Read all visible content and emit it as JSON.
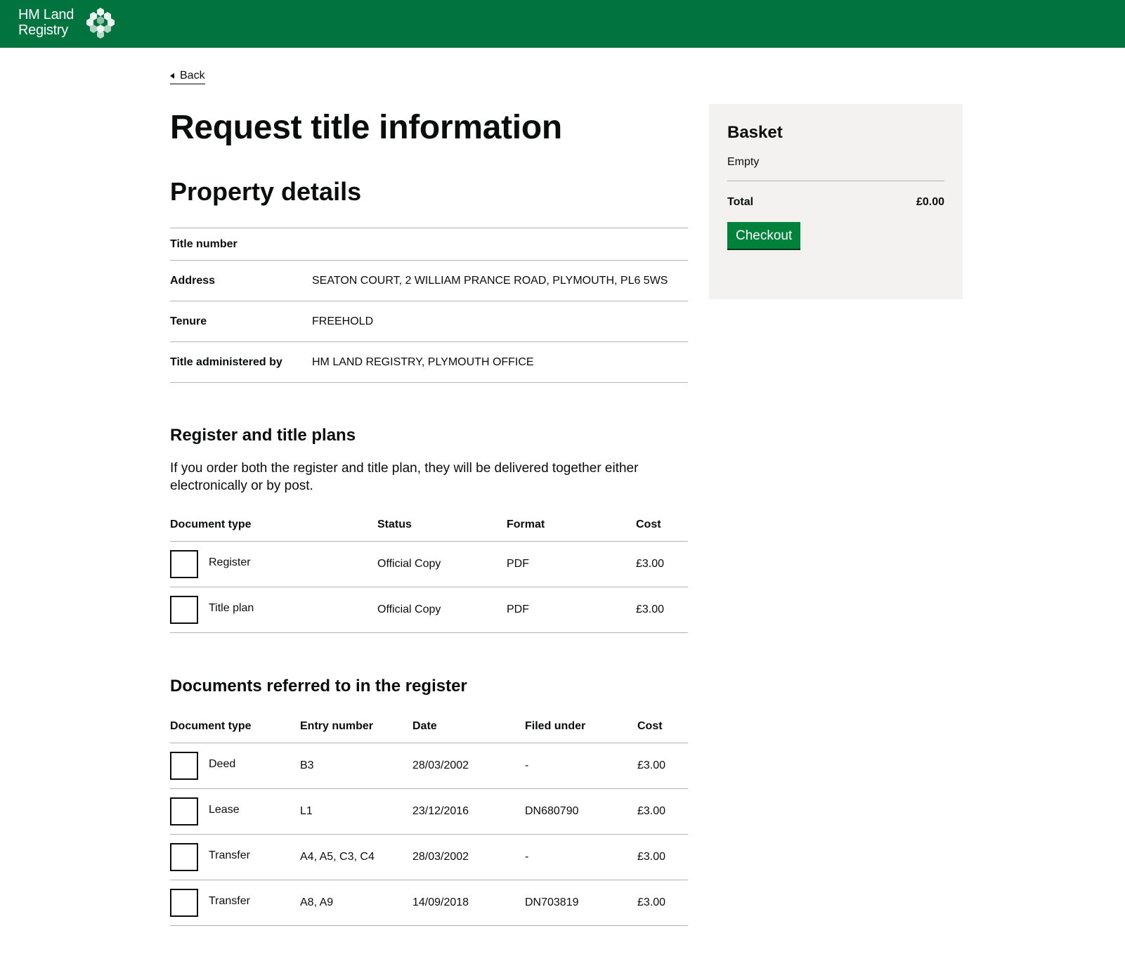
{
  "header": {
    "logo_line1": "HM Land",
    "logo_line2": "Registry",
    "brand_color": "#00733e",
    "logo_icon": "hm-land-registry-crest-icon"
  },
  "back_link": {
    "label": "Back",
    "icon": "chevron-left-icon"
  },
  "page_title": "Request title information",
  "property": {
    "heading": "Property details",
    "rows": [
      {
        "key": "Title number",
        "value": ""
      },
      {
        "key": "Address",
        "value": "SEATON COURT, 2 WILLIAM PRANCE ROAD, PLYMOUTH, PL6 5WS"
      },
      {
        "key": "Tenure",
        "value": "FREEHOLD"
      },
      {
        "key": "Title administered by",
        "value": "HM LAND REGISTRY, PLYMOUTH OFFICE"
      }
    ]
  },
  "register_plans": {
    "heading": "Register and title plans",
    "intro": "If you order both the register and title plan, they will be delivered together either electronically or by post.",
    "columns": [
      "Document type",
      "Status",
      "Format",
      "Cost"
    ],
    "rows": [
      {
        "type": "Register",
        "status": "Official Copy",
        "format": "PDF",
        "cost": "£3.00"
      },
      {
        "type": "Title plan",
        "status": "Official Copy",
        "format": "PDF",
        "cost": "£3.00"
      }
    ]
  },
  "referred_docs": {
    "heading": "Documents referred to in the register",
    "columns": [
      "Document type",
      "Entry number",
      "Date",
      "Filed under",
      "Cost"
    ],
    "rows": [
      {
        "type": "Deed",
        "entry": "B3",
        "date": "28/03/2002",
        "filed": "-",
        "cost": "£3.00"
      },
      {
        "type": "Lease",
        "entry": "L1",
        "date": "23/12/2016",
        "filed": "DN680790",
        "cost": "£3.00"
      },
      {
        "type": "Transfer",
        "entry": "A4, A5, C3, C4",
        "date": "28/03/2002",
        "filed": "-",
        "cost": "£3.00"
      },
      {
        "type": "Transfer",
        "entry": "A8, A9",
        "date": "14/09/2018",
        "filed": "DN703819",
        "cost": "£3.00"
      }
    ]
  },
  "basket": {
    "heading": "Basket",
    "empty_text": "Empty",
    "total_label": "Total",
    "total_value": "£0.00",
    "checkout_label": "Checkout",
    "button_color": "#00823b"
  }
}
